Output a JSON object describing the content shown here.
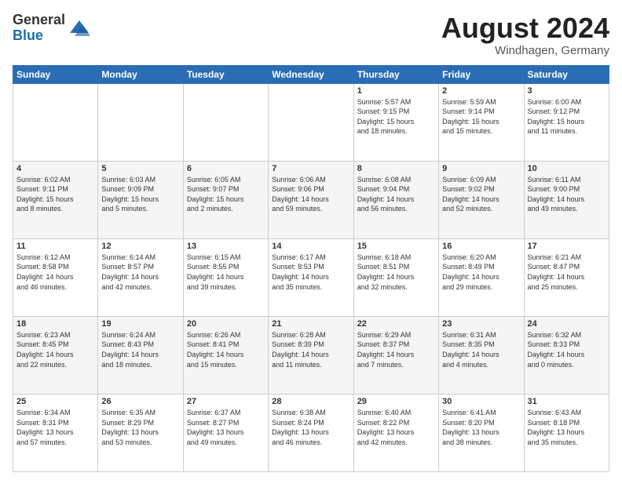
{
  "logo": {
    "general": "General",
    "blue": "Blue"
  },
  "title": "August 2024",
  "location": "Windhagen, Germany",
  "days_of_week": [
    "Sunday",
    "Monday",
    "Tuesday",
    "Wednesday",
    "Thursday",
    "Friday",
    "Saturday"
  ],
  "weeks": [
    [
      {
        "day": "",
        "info": ""
      },
      {
        "day": "",
        "info": ""
      },
      {
        "day": "",
        "info": ""
      },
      {
        "day": "",
        "info": ""
      },
      {
        "day": "1",
        "info": "Sunrise: 5:57 AM\nSunset: 9:15 PM\nDaylight: 15 hours\nand 18 minutes."
      },
      {
        "day": "2",
        "info": "Sunrise: 5:59 AM\nSunset: 9:14 PM\nDaylight: 15 hours\nand 15 minutes."
      },
      {
        "day": "3",
        "info": "Sunrise: 6:00 AM\nSunset: 9:12 PM\nDaylight: 15 hours\nand 11 minutes."
      }
    ],
    [
      {
        "day": "4",
        "info": "Sunrise: 6:02 AM\nSunset: 9:11 PM\nDaylight: 15 hours\nand 8 minutes."
      },
      {
        "day": "5",
        "info": "Sunrise: 6:03 AM\nSunset: 9:09 PM\nDaylight: 15 hours\nand 5 minutes."
      },
      {
        "day": "6",
        "info": "Sunrise: 6:05 AM\nSunset: 9:07 PM\nDaylight: 15 hours\nand 2 minutes."
      },
      {
        "day": "7",
        "info": "Sunrise: 6:06 AM\nSunset: 9:06 PM\nDaylight: 14 hours\nand 59 minutes."
      },
      {
        "day": "8",
        "info": "Sunrise: 6:08 AM\nSunset: 9:04 PM\nDaylight: 14 hours\nand 56 minutes."
      },
      {
        "day": "9",
        "info": "Sunrise: 6:09 AM\nSunset: 9:02 PM\nDaylight: 14 hours\nand 52 minutes."
      },
      {
        "day": "10",
        "info": "Sunrise: 6:11 AM\nSunset: 9:00 PM\nDaylight: 14 hours\nand 49 minutes."
      }
    ],
    [
      {
        "day": "11",
        "info": "Sunrise: 6:12 AM\nSunset: 8:58 PM\nDaylight: 14 hours\nand 46 minutes."
      },
      {
        "day": "12",
        "info": "Sunrise: 6:14 AM\nSunset: 8:57 PM\nDaylight: 14 hours\nand 42 minutes."
      },
      {
        "day": "13",
        "info": "Sunrise: 6:15 AM\nSunset: 8:55 PM\nDaylight: 14 hours\nand 39 minutes."
      },
      {
        "day": "14",
        "info": "Sunrise: 6:17 AM\nSunset: 8:53 PM\nDaylight: 14 hours\nand 35 minutes."
      },
      {
        "day": "15",
        "info": "Sunrise: 6:18 AM\nSunset: 8:51 PM\nDaylight: 14 hours\nand 32 minutes."
      },
      {
        "day": "16",
        "info": "Sunrise: 6:20 AM\nSunset: 8:49 PM\nDaylight: 14 hours\nand 29 minutes."
      },
      {
        "day": "17",
        "info": "Sunrise: 6:21 AM\nSunset: 8:47 PM\nDaylight: 14 hours\nand 25 minutes."
      }
    ],
    [
      {
        "day": "18",
        "info": "Sunrise: 6:23 AM\nSunset: 8:45 PM\nDaylight: 14 hours\nand 22 minutes."
      },
      {
        "day": "19",
        "info": "Sunrise: 6:24 AM\nSunset: 8:43 PM\nDaylight: 14 hours\nand 18 minutes."
      },
      {
        "day": "20",
        "info": "Sunrise: 6:26 AM\nSunset: 8:41 PM\nDaylight: 14 hours\nand 15 minutes."
      },
      {
        "day": "21",
        "info": "Sunrise: 6:28 AM\nSunset: 8:39 PM\nDaylight: 14 hours\nand 11 minutes."
      },
      {
        "day": "22",
        "info": "Sunrise: 6:29 AM\nSunset: 8:37 PM\nDaylight: 14 hours\nand 7 minutes."
      },
      {
        "day": "23",
        "info": "Sunrise: 6:31 AM\nSunset: 8:35 PM\nDaylight: 14 hours\nand 4 minutes."
      },
      {
        "day": "24",
        "info": "Sunrise: 6:32 AM\nSunset: 8:33 PM\nDaylight: 14 hours\nand 0 minutes."
      }
    ],
    [
      {
        "day": "25",
        "info": "Sunrise: 6:34 AM\nSunset: 8:31 PM\nDaylight: 13 hours\nand 57 minutes."
      },
      {
        "day": "26",
        "info": "Sunrise: 6:35 AM\nSunset: 8:29 PM\nDaylight: 13 hours\nand 53 minutes."
      },
      {
        "day": "27",
        "info": "Sunrise: 6:37 AM\nSunset: 8:27 PM\nDaylight: 13 hours\nand 49 minutes."
      },
      {
        "day": "28",
        "info": "Sunrise: 6:38 AM\nSunset: 8:24 PM\nDaylight: 13 hours\nand 46 minutes."
      },
      {
        "day": "29",
        "info": "Sunrise: 6:40 AM\nSunset: 8:22 PM\nDaylight: 13 hours\nand 42 minutes."
      },
      {
        "day": "30",
        "info": "Sunrise: 6:41 AM\nSunset: 8:20 PM\nDaylight: 13 hours\nand 38 minutes."
      },
      {
        "day": "31",
        "info": "Sunrise: 6:43 AM\nSunset: 8:18 PM\nDaylight: 13 hours\nand 35 minutes."
      }
    ]
  ]
}
